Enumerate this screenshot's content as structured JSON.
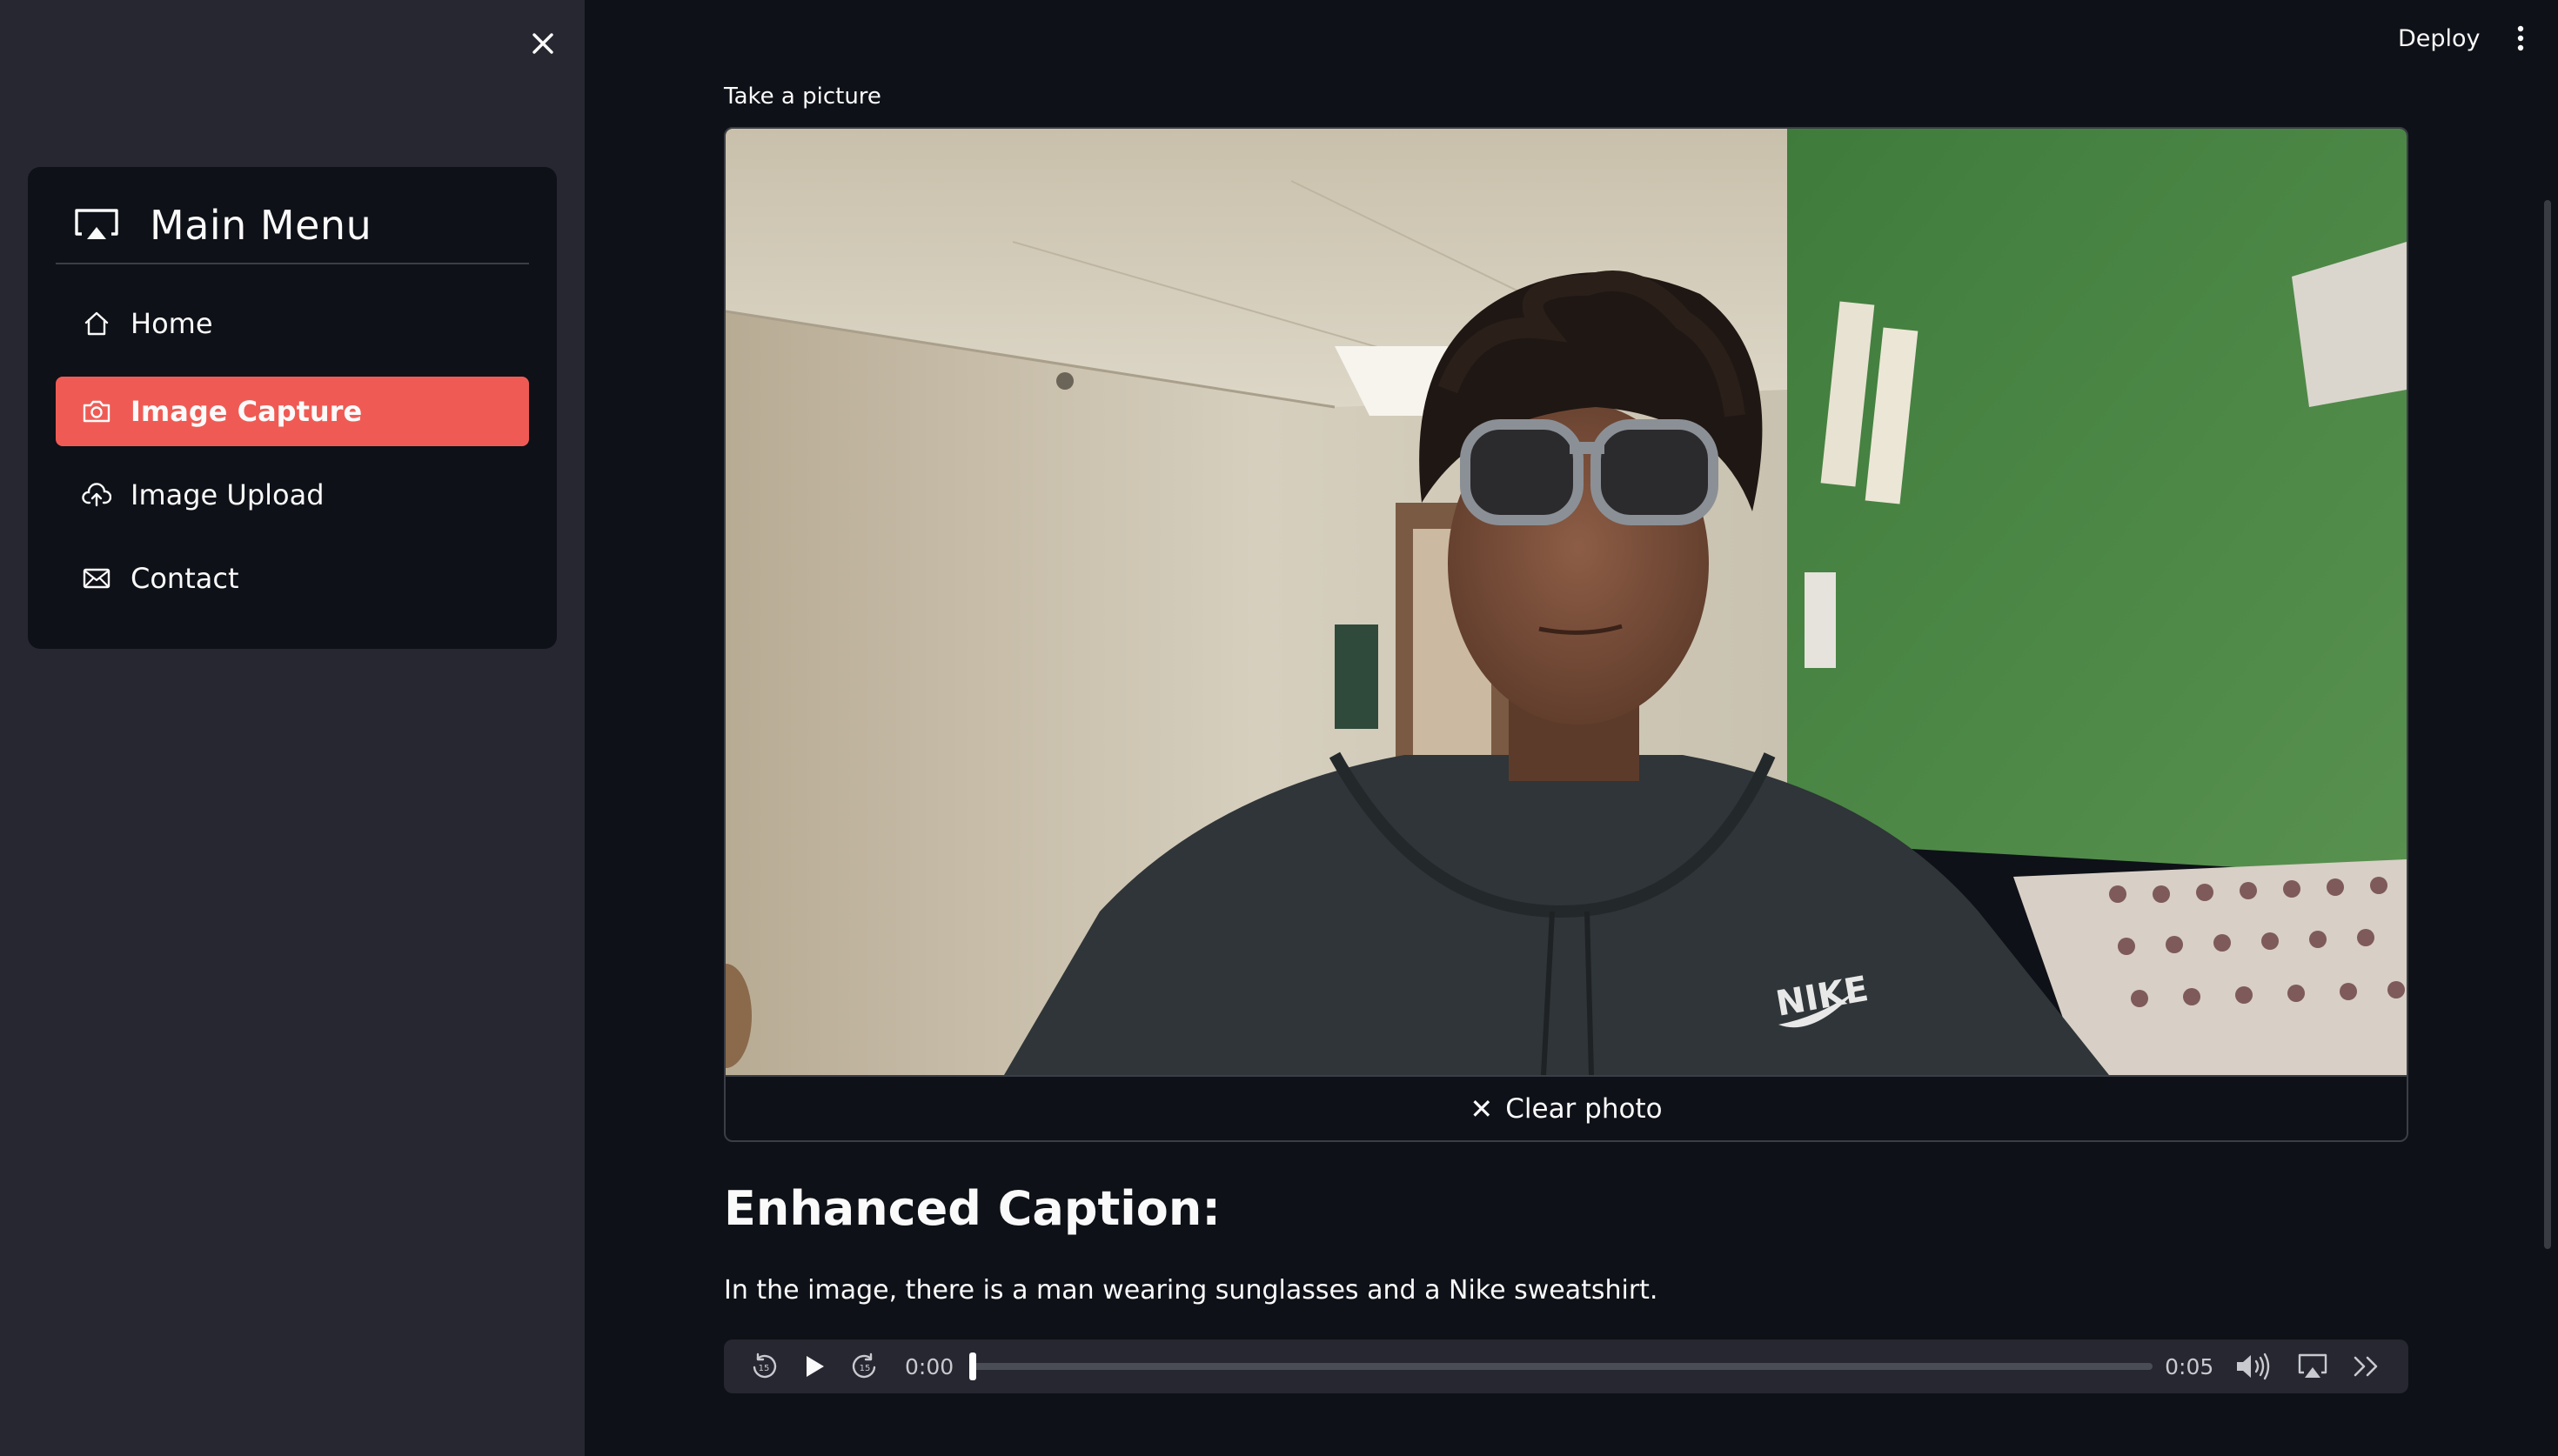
{
  "sidebar": {
    "menu_title": "Main Menu",
    "items": [
      {
        "label": "Home",
        "icon": "house-icon",
        "active": false
      },
      {
        "label": "Image Capture",
        "icon": "camera-icon",
        "active": true
      },
      {
        "label": "Image Upload",
        "icon": "cloud-upload-icon",
        "active": false
      },
      {
        "label": "Contact",
        "icon": "envelope-icon",
        "active": false
      }
    ],
    "active_color": "#ef5b54"
  },
  "header": {
    "deploy_label": "Deploy"
  },
  "camera": {
    "label": "Take a picture",
    "clear_label": "Clear photo"
  },
  "caption": {
    "heading": "Enhanced Caption:",
    "text": "In the image, there is a man wearing sunglasses and a Nike sweatshirt."
  },
  "audio": {
    "current_time": "0:00",
    "duration": "0:05",
    "progress": 0.0
  },
  "colors": {
    "background": "#0e1117",
    "sidebar_bg": "#262730",
    "accent": "#ef5b54"
  }
}
